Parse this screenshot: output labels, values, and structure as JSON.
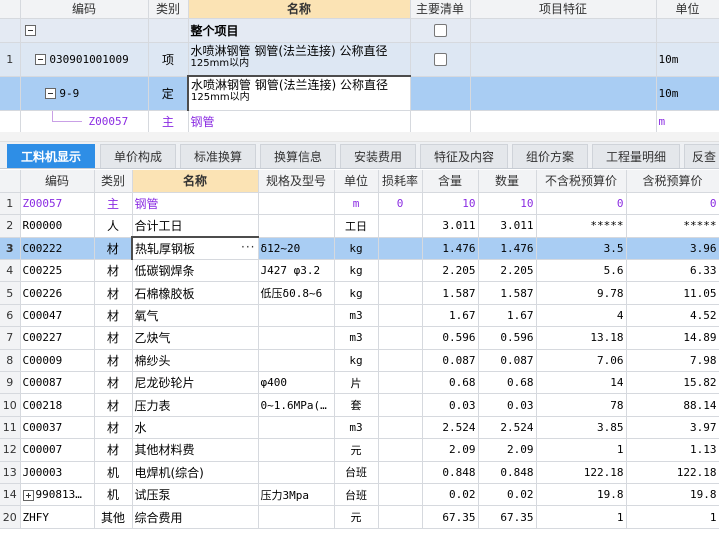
{
  "top_grid": {
    "headers": [
      "编码",
      "类别",
      "名称",
      "主要清单",
      "项目特征",
      "单位"
    ],
    "whole_project": {
      "label": "整个项目"
    },
    "rows": [
      {
        "rownum": "1",
        "code": "030901001009",
        "category": "项",
        "name1": "水喷淋钢管 钢管(法兰连接) 公称直径",
        "name2": "125mm以内",
        "unit": "10m"
      },
      {
        "rownum": "",
        "code": "9-9",
        "category": "定",
        "name1": "水喷淋钢管 钢管(法兰连接) 公称直径",
        "name2": "125mm以内",
        "unit": "10m"
      },
      {
        "rownum": "",
        "code": "Z00057",
        "category": "主",
        "name1": "钢管",
        "name2": "",
        "unit": "m"
      }
    ]
  },
  "tabs": [
    "工料机显示",
    "单价构成",
    "标准换算",
    "换算信息",
    "安装费用",
    "特征及内容",
    "组价方案",
    "工程量明细",
    "反查"
  ],
  "bottom_grid": {
    "headers": [
      "编码",
      "类别",
      "名称",
      "规格及型号",
      "单位",
      "损耗率",
      "含量",
      "数量",
      "不含税预算价",
      "含税预算价"
    ],
    "rows": [
      {
        "rownum": "1",
        "code": "Z00057",
        "cat": "主",
        "name": "钢管",
        "spec": "",
        "unit": "m",
        "loss": "0",
        "content": "10",
        "qty": "10",
        "price_ex": "0",
        "price_in": "0"
      },
      {
        "rownum": "2",
        "code": "R00000",
        "cat": "人",
        "name": "合计工日",
        "spec": "",
        "unit": "工日",
        "loss": "",
        "content": "3.011",
        "qty": "3.011",
        "price_ex": "*****",
        "price_in": "*****"
      },
      {
        "rownum": "3",
        "code": "C00222",
        "cat": "材",
        "name": "热轧厚钢板",
        "spec": "δ12~20",
        "unit": "kg",
        "loss": "",
        "content": "1.476",
        "qty": "1.476",
        "price_ex": "3.5",
        "price_in": "3.96"
      },
      {
        "rownum": "4",
        "code": "C00225",
        "cat": "材",
        "name": "低碳钢焊条",
        "spec": "J427 φ3.2",
        "unit": "kg",
        "loss": "",
        "content": "2.205",
        "qty": "2.205",
        "price_ex": "5.6",
        "price_in": "6.33"
      },
      {
        "rownum": "5",
        "code": "C00226",
        "cat": "材",
        "name": "石棉橡胶板",
        "spec": "低压δ0.8~6",
        "unit": "kg",
        "loss": "",
        "content": "1.587",
        "qty": "1.587",
        "price_ex": "9.78",
        "price_in": "11.05"
      },
      {
        "rownum": "6",
        "code": "C00047",
        "cat": "材",
        "name": "氧气",
        "spec": "",
        "unit": "m3",
        "loss": "",
        "content": "1.67",
        "qty": "1.67",
        "price_ex": "4",
        "price_in": "4.52"
      },
      {
        "rownum": "7",
        "code": "C00227",
        "cat": "材",
        "name": "乙炔气",
        "spec": "",
        "unit": "m3",
        "loss": "",
        "content": "0.596",
        "qty": "0.596",
        "price_ex": "13.18",
        "price_in": "14.89"
      },
      {
        "rownum": "8",
        "code": "C00009",
        "cat": "材",
        "name": "棉纱头",
        "spec": "",
        "unit": "kg",
        "loss": "",
        "content": "0.087",
        "qty": "0.087",
        "price_ex": "7.06",
        "price_in": "7.98"
      },
      {
        "rownum": "9",
        "code": "C00087",
        "cat": "材",
        "name": "尼龙砂轮片",
        "spec": "φ400",
        "unit": "片",
        "loss": "",
        "content": "0.68",
        "qty": "0.68",
        "price_ex": "14",
        "price_in": "15.82"
      },
      {
        "rownum": "10",
        "code": "C00218",
        "cat": "材",
        "name": "压力表",
        "spec": "0~1.6MPa(…",
        "unit": "套",
        "loss": "",
        "content": "0.03",
        "qty": "0.03",
        "price_ex": "78",
        "price_in": "88.14"
      },
      {
        "rownum": "11",
        "code": "C00037",
        "cat": "材",
        "name": "水",
        "spec": "",
        "unit": "m3",
        "loss": "",
        "content": "2.524",
        "qty": "2.524",
        "price_ex": "3.85",
        "price_in": "3.97"
      },
      {
        "rownum": "12",
        "code": "C00007",
        "cat": "材",
        "name": "其他材料费",
        "spec": "",
        "unit": "元",
        "loss": "",
        "content": "2.09",
        "qty": "2.09",
        "price_ex": "1",
        "price_in": "1.13"
      },
      {
        "rownum": "13",
        "code": "J00003",
        "cat": "机",
        "name": "电焊机(综合)",
        "spec": "",
        "unit": "台班",
        "loss": "",
        "content": "0.848",
        "qty": "0.848",
        "price_ex": "122.18",
        "price_in": "122.18"
      },
      {
        "rownum": "14",
        "code": "990813…",
        "cat": "机",
        "name": "试压泵",
        "spec": "压力3Mpa",
        "unit": "台班",
        "loss": "",
        "content": "0.02",
        "qty": "0.02",
        "price_ex": "19.8",
        "price_in": "19.8"
      },
      {
        "rownum": "20",
        "code": "ZHFY",
        "cat": "其他",
        "name": "综合费用",
        "spec": "",
        "unit": "元",
        "loss": "",
        "content": "67.35",
        "qty": "67.35",
        "price_ex": "1",
        "price_in": "1"
      }
    ]
  },
  "colors": {
    "selection": "#a9cdf3",
    "header_highlight": "#fbe3b4",
    "tab_active": "#2e8ee6",
    "main_material": "#8a2be2"
  }
}
